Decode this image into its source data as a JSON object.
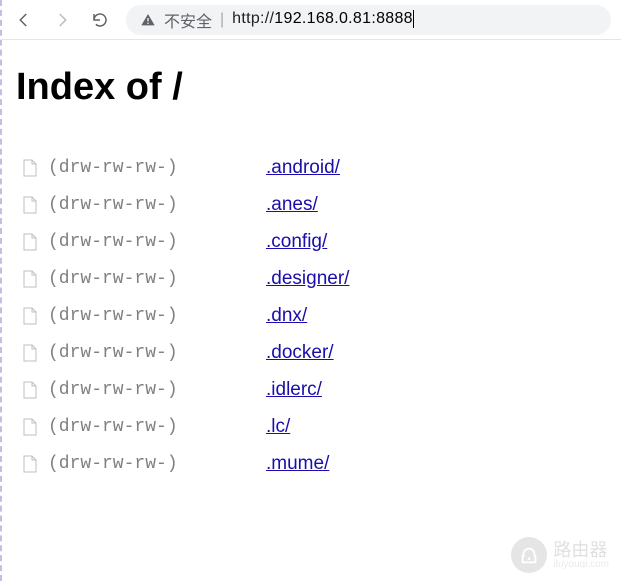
{
  "toolbar": {
    "insecure_label": "不安全",
    "url_prefix": "http://",
    "url_host": "192.168.0.81:8888"
  },
  "page": {
    "title": "Index of /"
  },
  "listing": [
    {
      "perms": "(drw-rw-rw-)",
      "name": ".android/"
    },
    {
      "perms": "(drw-rw-rw-)",
      "name": ".anes/"
    },
    {
      "perms": "(drw-rw-rw-)",
      "name": ".config/"
    },
    {
      "perms": "(drw-rw-rw-)",
      "name": ".designer/"
    },
    {
      "perms": "(drw-rw-rw-)",
      "name": ".dnx/"
    },
    {
      "perms": "(drw-rw-rw-)",
      "name": ".docker/"
    },
    {
      "perms": "(drw-rw-rw-)",
      "name": ".idlerc/"
    },
    {
      "perms": "(drw-rw-rw-)",
      "name": ".lc/"
    },
    {
      "perms": "(drw-rw-rw-)",
      "name": ".mume/"
    }
  ],
  "watermark": {
    "text": "路由器",
    "sub": "iluyouqi.com"
  }
}
